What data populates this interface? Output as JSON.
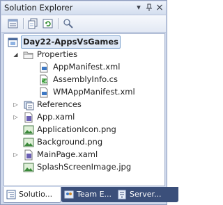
{
  "window": {
    "title": "Solution Explorer",
    "buttons": {
      "dropdown": "▾",
      "pin": "📌",
      "close": "×"
    }
  },
  "toolbar": {
    "buttons": [
      "properties-icon",
      "show-all-files-icon",
      "refresh-icon",
      "view-class-diagram-icon"
    ]
  },
  "tree": {
    "project": {
      "label": "Day22-AppsVsGames",
      "icon": "project-icon"
    },
    "items": [
      {
        "label": "Properties",
        "icon": "folder-icon",
        "expanded": true
      },
      {
        "label": "AppManifest.xml",
        "icon": "xml-file-icon"
      },
      {
        "label": "AssemblyInfo.cs",
        "icon": "csharp-file-icon"
      },
      {
        "label": "WMAppManifest.xml",
        "icon": "xml-file-icon"
      },
      {
        "label": "References",
        "icon": "references-icon",
        "expanded": false
      },
      {
        "label": "App.xaml",
        "icon": "xaml-file-icon",
        "expanded": false
      },
      {
        "label": "ApplicationIcon.png",
        "icon": "image-file-icon"
      },
      {
        "label": "Background.png",
        "icon": "image-file-icon"
      },
      {
        "label": "MainPage.xaml",
        "icon": "xaml-file-icon",
        "expanded": false
      },
      {
        "label": "SplashScreenImage.jpg",
        "icon": "image-file-icon"
      }
    ]
  },
  "tabs": [
    {
      "label": "Solutio...",
      "icon": "solution-explorer-icon",
      "active": true
    },
    {
      "label": "Team E...",
      "icon": "team-explorer-icon",
      "active": false
    },
    {
      "label": "Server...",
      "icon": "server-explorer-icon",
      "active": false
    }
  ],
  "colors": {
    "chrome": "#cfd9ec",
    "selection_border": "#7da2ce",
    "inactive_tab": "#3b4f7a"
  }
}
